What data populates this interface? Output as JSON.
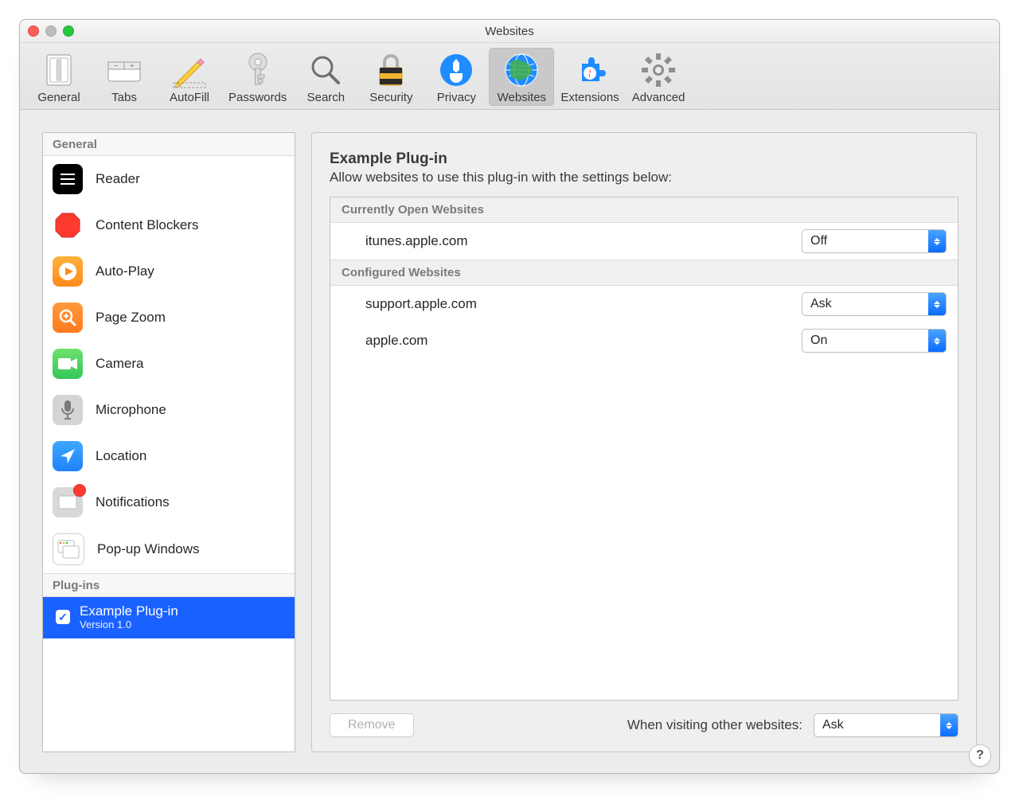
{
  "window_title": "Websites",
  "toolbar": [
    {
      "id": "general",
      "label": "General"
    },
    {
      "id": "tabs",
      "label": "Tabs"
    },
    {
      "id": "autofill",
      "label": "AutoFill"
    },
    {
      "id": "passwords",
      "label": "Passwords"
    },
    {
      "id": "search",
      "label": "Search"
    },
    {
      "id": "security",
      "label": "Security"
    },
    {
      "id": "privacy",
      "label": "Privacy"
    },
    {
      "id": "websites",
      "label": "Websites",
      "selected": true
    },
    {
      "id": "extensions",
      "label": "Extensions"
    },
    {
      "id": "advanced",
      "label": "Advanced"
    }
  ],
  "sidebar": {
    "section_general": "General",
    "items": [
      {
        "label": "Reader"
      },
      {
        "label": "Content Blockers"
      },
      {
        "label": "Auto-Play"
      },
      {
        "label": "Page Zoom"
      },
      {
        "label": "Camera"
      },
      {
        "label": "Microphone"
      },
      {
        "label": "Location"
      },
      {
        "label": "Notifications",
        "badge": true
      },
      {
        "label": "Pop-up Windows"
      }
    ],
    "section_plugins": "Plug-ins",
    "plugin": {
      "checked": true,
      "title": "Example Plug-in",
      "version": "Version 1.0"
    }
  },
  "main": {
    "title": "Example Plug-in",
    "description": "Allow websites to use this plug-in with the settings below:",
    "open_header": "Currently Open Websites",
    "open_sites": [
      {
        "domain": "itunes.apple.com",
        "value": "Off"
      }
    ],
    "configured_header": "Configured Websites",
    "configured_sites": [
      {
        "domain": "support.apple.com",
        "value": "Ask"
      },
      {
        "domain": "apple.com",
        "value": "On"
      }
    ],
    "remove_label": "Remove",
    "other_label": "When visiting other websites:",
    "other_value": "Ask"
  },
  "help": "?"
}
